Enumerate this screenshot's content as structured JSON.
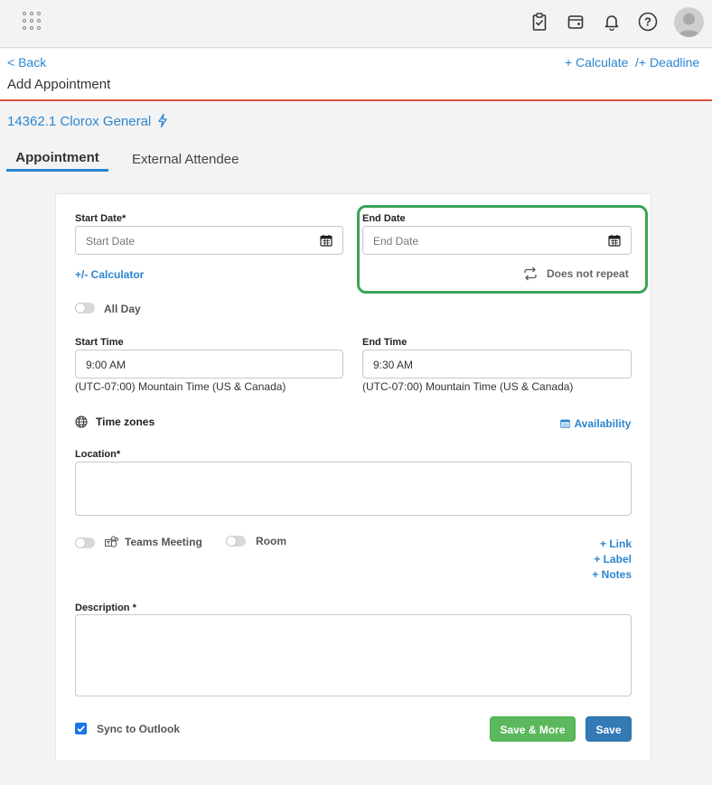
{
  "nav": {
    "back_label": "< Back",
    "page_title": "Add Appointment",
    "calculate_label": "+ Calculate",
    "deadline_label": "/+ Deadline"
  },
  "matter": {
    "label": "14362.1 Clorox General"
  },
  "tabs": [
    {
      "label": "Appointment",
      "active": true
    },
    {
      "label": "External Attendee",
      "active": false
    }
  ],
  "form": {
    "start_date": {
      "label": "Start Date*",
      "placeholder": "Start Date",
      "value": ""
    },
    "end_date": {
      "label": "End Date",
      "placeholder": "End Date",
      "value": ""
    },
    "calculator_label": "+/- Calculator",
    "repeat_label": "Does not repeat",
    "all_day_label": "All Day",
    "start_time": {
      "label": "Start Time",
      "value": "9:00 AM",
      "timezone": "(UTC-07:00) Mountain Time (US & Canada)"
    },
    "end_time": {
      "label": "End Time",
      "value": "9:30 AM",
      "timezone": "(UTC-07:00) Mountain Time (US & Canada)"
    },
    "time_zones_label": "Time zones",
    "availability_label": "Availability",
    "location": {
      "label": "Location*",
      "value": ""
    },
    "teams_meeting_label": "Teams Meeting",
    "room_label": "Room",
    "add_link_label": "+ Link",
    "add_label_label": "+ Label",
    "add_notes_label": "+ Notes",
    "description": {
      "label": "Description *",
      "value": ""
    },
    "sync_outlook_label": "Sync to Outlook",
    "sync_outlook_checked": true,
    "save_more_label": "Save & More",
    "save_label": "Save"
  },
  "colors": {
    "accent_blue": "#2a86d1",
    "header_rule": "#e0533d",
    "highlight_green": "#3aa457",
    "save_more_green": "#5cb85c",
    "save_blue": "#337ab7"
  },
  "icons": [
    "apps-grid-icon",
    "clipboard-check-icon",
    "wallet-icon",
    "bell-icon",
    "help-icon",
    "user-avatar-icon",
    "lightning-icon",
    "calendar-icon",
    "repeat-icon",
    "globe-icon",
    "teams-icon"
  ]
}
